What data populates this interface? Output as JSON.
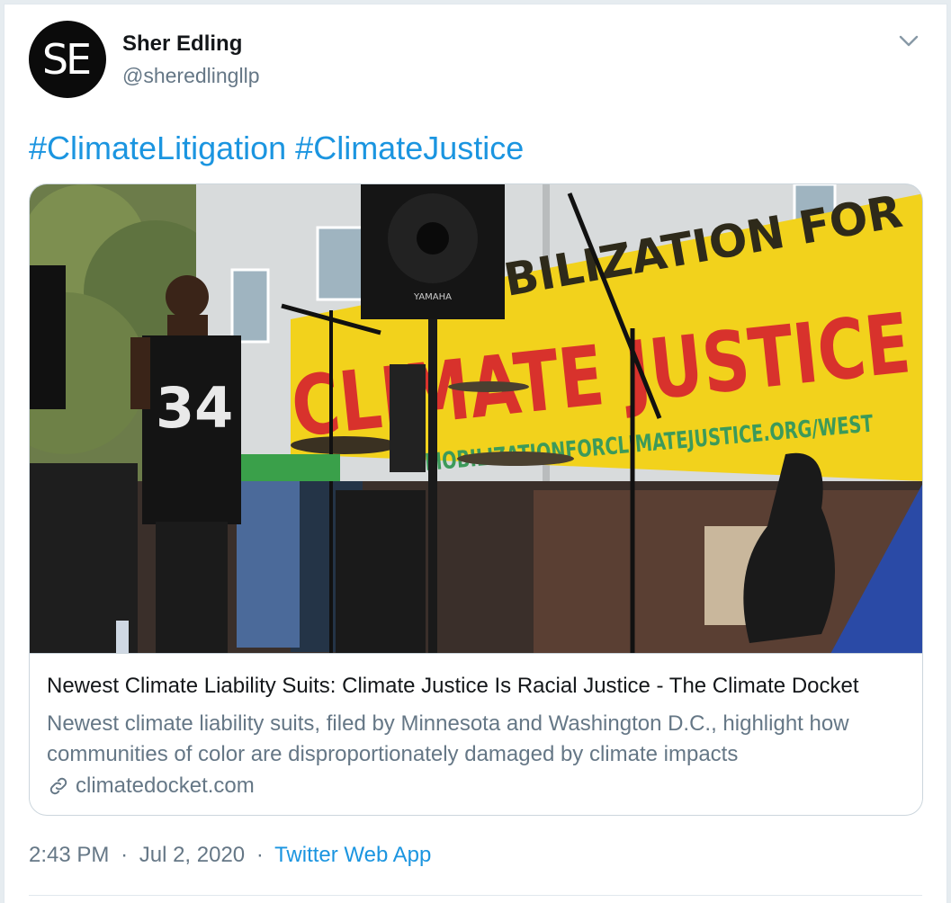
{
  "author": {
    "avatar_text": "SE",
    "name": "Sher Edling",
    "handle": "@sheredlingllp"
  },
  "icons": {
    "menu": "chevron-down-icon",
    "link": "link-icon"
  },
  "tweet": {
    "hashtags": [
      "#ClimateLitigation",
      "#ClimateJustice"
    ]
  },
  "card": {
    "image": {
      "banner_lines": [
        "MOBILIZATION FOR",
        "CLIMATE JUSTICE",
        "MOBILIZATIONFORCLIMATEJUSTICE.ORG/WEST"
      ],
      "speaker_brand": "YAMAHA",
      "jersey_number": "34"
    },
    "title": "Newest Climate Liability Suits: Climate Justice Is Racial Justice - The Climate Docket",
    "description": "Newest climate liability suits, filed by Minnesota and Washington D.C., highlight how communities of color are disproportionately damaged by climate impacts",
    "domain": "climatedocket.com"
  },
  "meta": {
    "time": "2:43 PM",
    "separator": "·",
    "date": "Jul 2, 2020",
    "source": "Twitter Web App"
  },
  "colors": {
    "link_blue": "#1b95e0",
    "secondary_text": "#657786",
    "border": "#ccd6dd"
  }
}
